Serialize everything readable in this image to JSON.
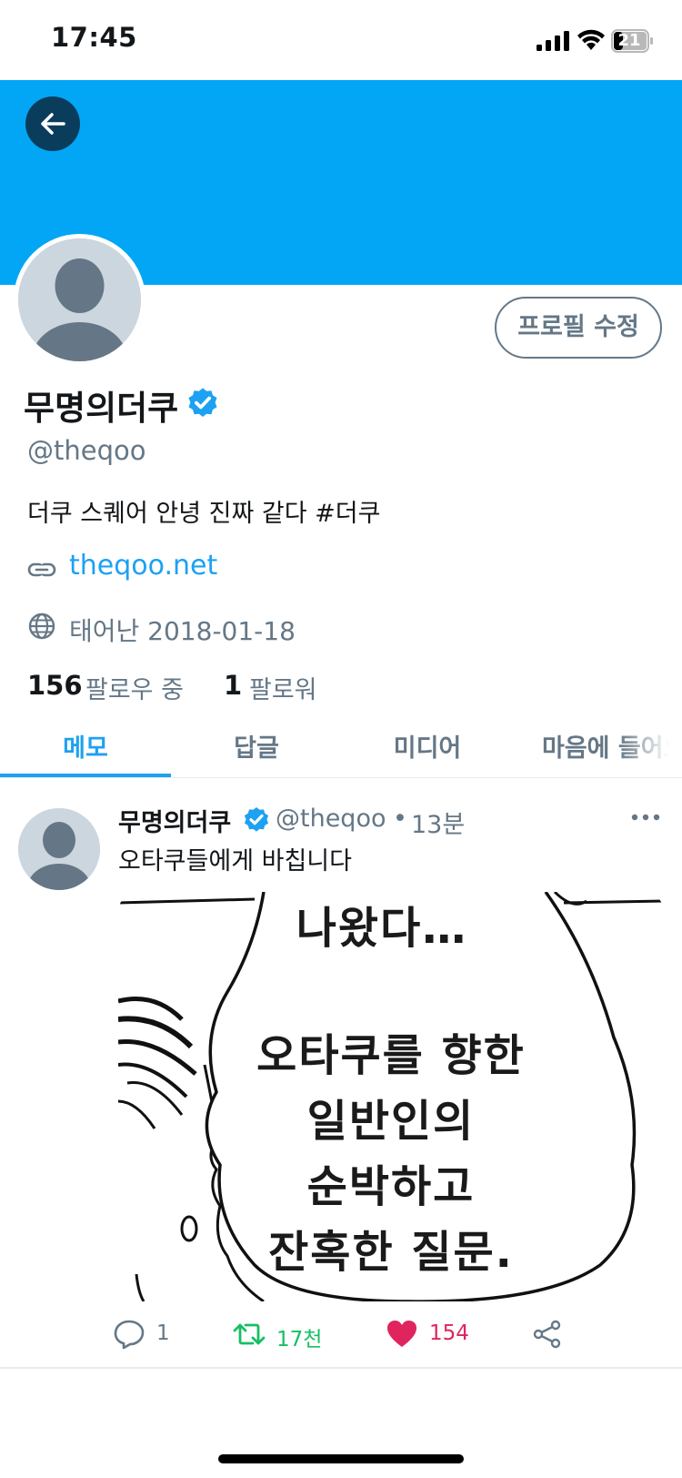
{
  "status_bar": {
    "time": "17:45",
    "battery": "21"
  },
  "profile": {
    "display_name": "무명의더쿠",
    "handle": "@theqoo",
    "bio": "더쿠 스퀘어 안녕 진짜 같다 #더쿠",
    "website": "theqoo.net",
    "joined": "태어난 2018-01-18",
    "following_count": "156",
    "following_label": "팔로우 중",
    "followers_count": "1",
    "followers_label": "팔로워",
    "edit_label": "프로필 수정"
  },
  "tabs": [
    {
      "label": "메모",
      "active": true
    },
    {
      "label": "답글",
      "active": false
    },
    {
      "label": "미디어",
      "active": false
    },
    {
      "label": "마음에 들어요",
      "active": false
    }
  ],
  "tweet": {
    "author_name": "무명의더쿠",
    "author_handle": "@theqoo",
    "separator": "•",
    "time": "13분",
    "text": "오타쿠들에게 바칩니다",
    "image_lines": [
      "나왔다…",
      "오타쿠를 향한",
      "일반인의",
      "순박하고",
      "잔혹한 질문."
    ],
    "reply_count": "1",
    "retweet_count": "17천",
    "like_count": "154"
  },
  "colors": {
    "banner": "#03a6f4",
    "accent": "#1da1f2",
    "retweet": "#17bf63",
    "like": "#e0245e",
    "muted": "#657786"
  },
  "icons": [
    "back-arrow-icon",
    "verified-icon",
    "link-icon",
    "globe-icon",
    "more-icon",
    "reply-icon",
    "retweet-icon",
    "heart-icon",
    "share-icon"
  ]
}
